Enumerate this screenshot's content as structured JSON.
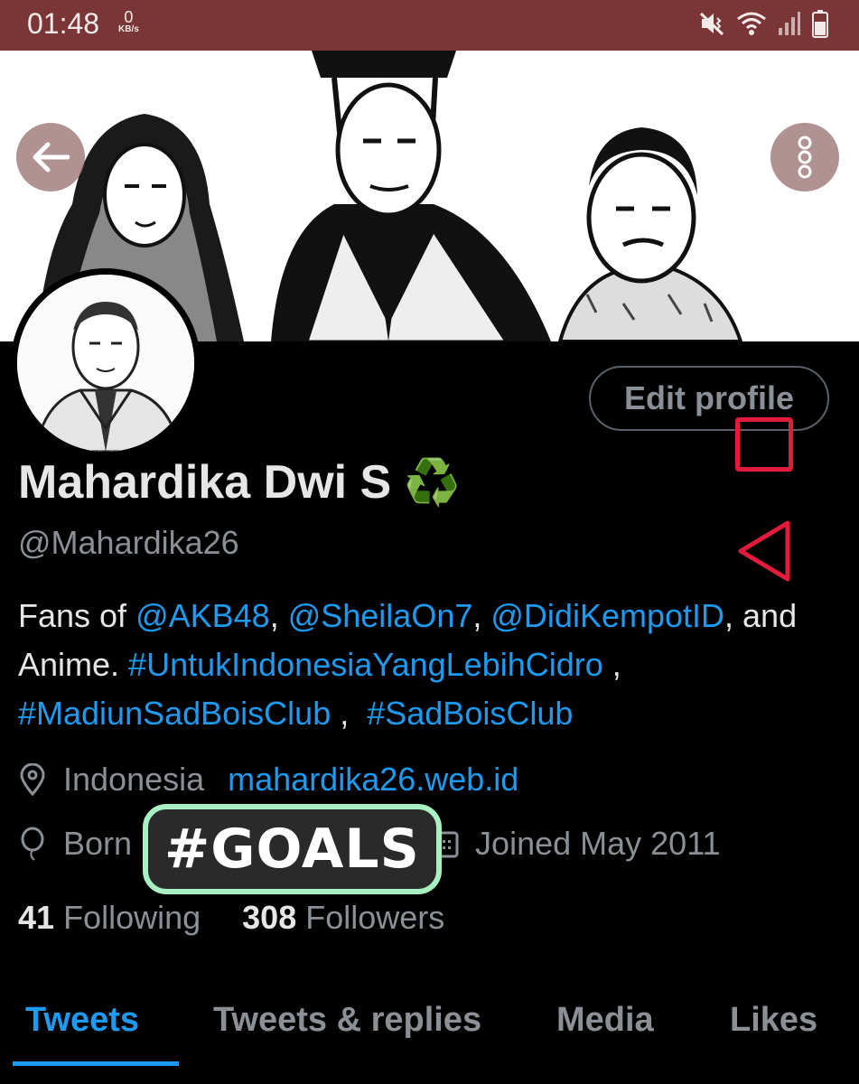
{
  "status_bar": {
    "time": "01:48",
    "net_speed": "0",
    "net_unit": "KB/s"
  },
  "banner": {
    "accent": "#7a3636"
  },
  "profile": {
    "edit_label": "Edit profile",
    "name": "Mahardika Dwi S",
    "name_emoji": "♻️",
    "handle": "@Mahardika26",
    "bio": {
      "p1": "Fans of ",
      "m1": "@AKB48",
      "p2": ", ",
      "m2": "@SheilaOn7",
      "p3": ", ",
      "m3": "@DidiKempotID",
      "p4": ", and Anime. ",
      "h1": "#UntukIndonesiaYangLebihCidro",
      "p5": " , ",
      "h2": "#MadiunSadBoisClub",
      "p6": " ,  ",
      "h3": "#SadBoisClub"
    },
    "location": "Indonesia",
    "website": "mahardika26.web.id",
    "birth_label": "Born",
    "joined": "Joined May 2011",
    "following_count": "41",
    "following_label": "Following",
    "followers_count": "308",
    "followers_label": "Followers"
  },
  "sticker": {
    "text": "#GOALS"
  },
  "tabs": [
    {
      "label": "Tweets",
      "active": true
    },
    {
      "label": "Tweets & replies"
    },
    {
      "label": "Media"
    },
    {
      "label": "Likes"
    }
  ],
  "colors": {
    "link": "#1d9bf0",
    "overlay": "#e11b3c",
    "sticker_outline": "#a8f0c2"
  }
}
